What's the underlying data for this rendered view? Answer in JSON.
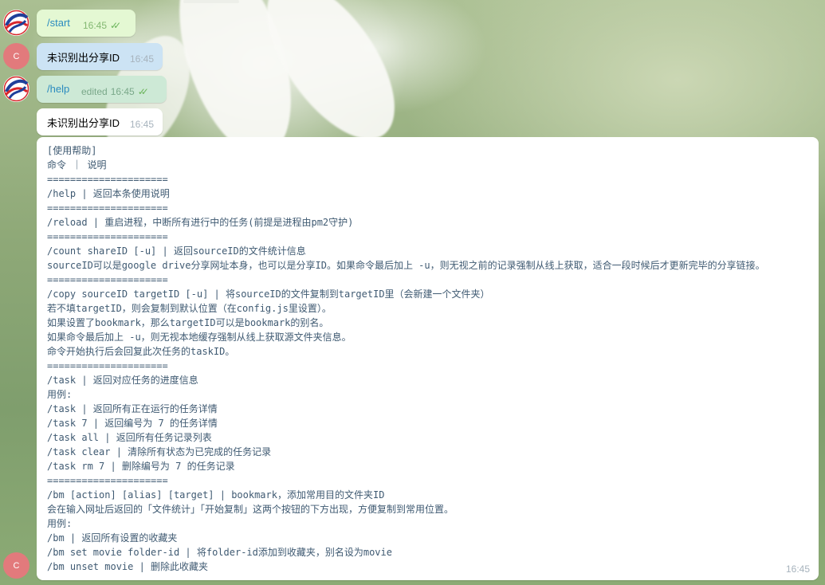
{
  "messages": [
    {
      "text": "/start",
      "time": "16:45"
    },
    {
      "text": "未识别出分享ID",
      "time": "16:45"
    },
    {
      "text": "/help",
      "edited_label": "edited",
      "time": "16:45"
    },
    {
      "text": "未识别出分享ID",
      "time": "16:45"
    }
  ],
  "bot_avatar_letter": "C",
  "help_message": {
    "time": "16:45",
    "lines": [
      "[使用帮助]",
      "命令 ｜ 说明",
      "=====================",
      "/help | 返回本条使用说明",
      "=====================",
      "/reload | 重启进程，中断所有进行中的任务(前提是进程由pm2守护)",
      "=====================",
      "/count shareID [-u] | 返回sourceID的文件统计信息",
      "sourceID可以是google drive分享网址本身，也可以是分享ID。如果命令最后加上 -u，则无视之前的记录强制从线上获取，适合一段时候后才更新完毕的分享链接。",
      "=====================",
      "/copy sourceID targetID [-u] | 将sourceID的文件复制到targetID里（会新建一个文件夹）",
      "若不填targetID，则会复制到默认位置（在config.js里设置）。",
      "如果设置了bookmark，那么targetID可以是bookmark的别名。",
      "如果命令最后加上 -u，则无视本地缓存强制从线上获取源文件夹信息。",
      "命令开始执行后会回复此次任务的taskID。",
      "=====================",
      "/task | 返回对应任务的进度信息",
      "用例:",
      "/task | 返回所有正在运行的任务详情",
      "/task 7 | 返回编号为 7 的任务详情",
      "/task all | 返回所有任务记录列表",
      "/task clear | 清除所有状态为已完成的任务记录",
      "/task rm 7 | 删除编号为 7 的任务记录",
      "=====================",
      "/bm [action] [alias] [target] | bookmark，添加常用目的文件夹ID",
      "会在输入网址后返回的「文件统计」「开始复制」这两个按钮的下方出现，方便复制到常用位置。",
      "用例:",
      "/bm | 返回所有设置的收藏夹",
      "/bm set movie folder-id | 将folder-id添加到收藏夹，别名设为movie",
      "/bm unset movie | 删除此收藏夹"
    ]
  },
  "colors": {
    "outgoing_bubble": "#e4f8d3",
    "incoming_bubble": "#ffffff",
    "command_link": "#2a8bbf",
    "read_check": "#6bb45b",
    "bot_avatar": "#e27a7c"
  }
}
